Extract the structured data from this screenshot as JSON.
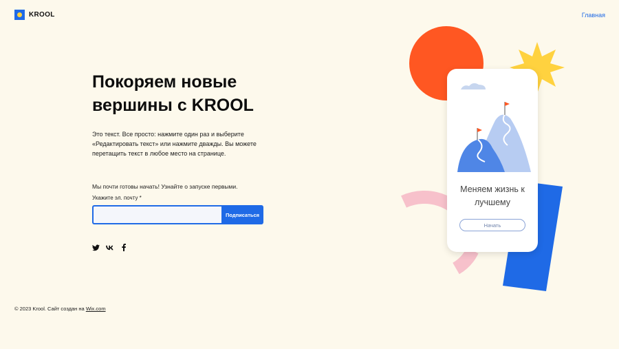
{
  "header": {
    "brand": "KROOL",
    "nav_home": "Главная"
  },
  "hero": {
    "title": "Покоряем новые вершины с KROOL",
    "text": "Это текст. Все просто: нажмите один раз и выберите «Редактировать текст» или нажмите дважды. Вы можете перетащить текст в любое место на странице."
  },
  "signup": {
    "lead": "Мы почти готовы начать! Узнайте о запуске первыми.",
    "email_label": "Укажите эл. почту *",
    "email_value": "",
    "button": "Подписаться"
  },
  "social": [
    "twitter-icon",
    "vk-icon",
    "facebook-icon"
  ],
  "footer": {
    "copyright": "© 2023 Krool. Сайт создан на ",
    "link": "Wix.com"
  },
  "illustration": {
    "caption": "Меняем жизнь к лучшему",
    "button": "Начать"
  },
  "colors": {
    "background": "#fdf9ec",
    "accent": "#1f6ae6",
    "sun_orange": "#ff5722",
    "star_yellow": "#ffd23f",
    "arc_pink": "#f7c1cb"
  }
}
